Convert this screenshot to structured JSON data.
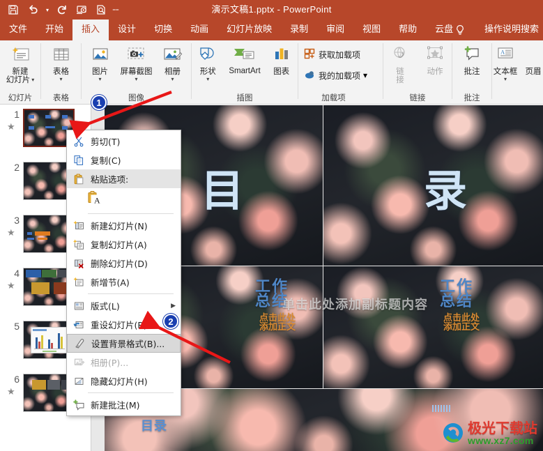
{
  "titlebar": {
    "document_title": "演示文稿1.pptx  -  PowerPoint",
    "quick_access": [
      {
        "name": "save-icon",
        "label": "保存"
      },
      {
        "name": "undo-icon",
        "label": "撤消"
      },
      {
        "name": "redo-icon",
        "label": "恢复"
      },
      {
        "name": "start-slideshow-icon",
        "label": "从头开始"
      },
      {
        "name": "print-preview-icon",
        "label": "打印预览和打印"
      },
      {
        "name": "customize-qat-icon",
        "label": "自定义快速访问工具栏"
      }
    ]
  },
  "tabs": [
    {
      "label": "文件",
      "active": false
    },
    {
      "label": "开始",
      "active": false
    },
    {
      "label": "插入",
      "active": true
    },
    {
      "label": "设计",
      "active": false
    },
    {
      "label": "切换",
      "active": false
    },
    {
      "label": "动画",
      "active": false
    },
    {
      "label": "幻灯片放映",
      "active": false
    },
    {
      "label": "录制",
      "active": false
    },
    {
      "label": "审阅",
      "active": false
    },
    {
      "label": "视图",
      "active": false
    },
    {
      "label": "帮助",
      "active": false
    },
    {
      "label": "云盘",
      "active": false
    }
  ],
  "tellme": {
    "label": "操作说明搜索",
    "icon": "lightbulb-icon"
  },
  "ribbon": {
    "groups": [
      {
        "id": "slides",
        "label": "幻灯片",
        "buttons": [
          {
            "name": "new-slide-button",
            "line1": "新建",
            "line2": "幻灯片",
            "icon": "new-slide-icon",
            "has_caret": true
          }
        ]
      },
      {
        "id": "tables",
        "label": "表格",
        "buttons": [
          {
            "name": "table-button",
            "line1": "表格",
            "line2": "",
            "icon": "table-icon",
            "has_caret": true
          }
        ]
      },
      {
        "id": "images",
        "label": "图像",
        "buttons": [
          {
            "name": "pictures-button",
            "line1": "图片",
            "line2": "",
            "icon": "picture-icon",
            "has_caret": true
          },
          {
            "name": "screenshot-button",
            "line1": "屏幕截图",
            "line2": "",
            "icon": "screenshot-icon",
            "has_caret": true
          },
          {
            "name": "photo-album-button",
            "line1": "相册",
            "line2": "",
            "icon": "photo-album-icon",
            "has_caret": true
          }
        ]
      },
      {
        "id": "illustrations",
        "label": "插图",
        "buttons": [
          {
            "name": "shapes-button",
            "line1": "形状",
            "line2": "",
            "icon": "shapes-icon",
            "has_caret": true
          },
          {
            "name": "smartart-button",
            "line1": "SmartArt",
            "line2": "",
            "icon": "smartart-icon",
            "has_caret": false
          },
          {
            "name": "chart-button",
            "line1": "图表",
            "line2": "",
            "icon": "chart-icon",
            "has_caret": false
          }
        ]
      },
      {
        "id": "addins",
        "label": "加载项",
        "small_buttons": [
          {
            "name": "get-addins-button",
            "label": "获取加载项",
            "icon": "store-icon"
          },
          {
            "name": "my-addins-button",
            "label": "我的加载项",
            "icon": "my-addins-icon",
            "has_caret": true
          }
        ]
      },
      {
        "id": "links",
        "label": "链接",
        "buttons": [
          {
            "name": "link-button",
            "line1": "链",
            "line2": "接",
            "icon": "link-icon",
            "has_caret": false,
            "disabled": true
          },
          {
            "name": "action-button",
            "line1": "动作",
            "line2": "",
            "icon": "action-icon",
            "has_caret": false,
            "disabled": true
          }
        ]
      },
      {
        "id": "comments",
        "label": "批注",
        "buttons": [
          {
            "name": "new-comment-button",
            "line1": "批注",
            "line2": "",
            "icon": "comment-icon",
            "has_caret": false
          }
        ]
      },
      {
        "id": "text",
        "label": "",
        "buttons": [
          {
            "name": "text-box-button",
            "line1": "文本框",
            "line2": "",
            "icon": "text-box-icon",
            "has_caret": true
          },
          {
            "name": "header-footer-button",
            "line1": "页眉",
            "line2": "",
            "icon": "header-footer-icon",
            "has_caret": false
          }
        ]
      }
    ]
  },
  "slide_panel": {
    "slides": [
      {
        "number": "1",
        "star": "★",
        "selected": true
      },
      {
        "number": "2",
        "star": "",
        "selected": false
      },
      {
        "number": "3",
        "star": "★",
        "selected": false
      },
      {
        "number": "4",
        "star": "★",
        "selected": false
      },
      {
        "number": "5",
        "star": "",
        "selected": false
      },
      {
        "number": "6",
        "star": "★",
        "selected": false
      }
    ]
  },
  "context_menu": {
    "items": [
      {
        "label": "剪切(T)",
        "icon": "cut-icon",
        "type": "item",
        "state": "normal"
      },
      {
        "label": "复制(C)",
        "icon": "copy-icon",
        "type": "item",
        "state": "normal"
      },
      {
        "label": "粘贴选项:",
        "icon": "paste-icon",
        "type": "header",
        "state": "highlight"
      },
      {
        "label": "",
        "icon": "paste-keep-text-icon",
        "type": "paste-gallery",
        "state": "normal"
      },
      {
        "type": "separator"
      },
      {
        "label": "新建幻灯片(N)",
        "icon": "new-slide-small-icon",
        "type": "item",
        "state": "normal"
      },
      {
        "label": "复制幻灯片(A)",
        "icon": "duplicate-slide-icon",
        "type": "item",
        "state": "normal"
      },
      {
        "label": "删除幻灯片(D)",
        "icon": "delete-slide-icon",
        "type": "item",
        "state": "normal"
      },
      {
        "label": "新增节(A)",
        "icon": "new-section-icon",
        "type": "item",
        "state": "normal"
      },
      {
        "type": "separator"
      },
      {
        "label": "版式(L)",
        "icon": "layout-icon",
        "type": "submenu",
        "state": "normal"
      },
      {
        "label": "重设幻灯片(R)",
        "icon": "reset-slide-icon",
        "type": "item",
        "state": "normal"
      },
      {
        "label": "设置背景格式(B)...",
        "icon": "format-background-icon",
        "type": "item",
        "state": "selected"
      },
      {
        "label": "相册(P)...",
        "icon": "photo-album-small-icon",
        "type": "item",
        "state": "disabled"
      },
      {
        "label": "隐藏幻灯片(H)",
        "icon": "hide-slide-icon",
        "type": "item",
        "state": "normal"
      },
      {
        "type": "separator"
      },
      {
        "label": "新建批注(M)",
        "icon": "new-comment-small-icon",
        "type": "item",
        "state": "normal"
      }
    ]
  },
  "slide_canvas": {
    "texts": {
      "contents_char_1": "目",
      "contents_char_2": "录",
      "work_title_left": "工作\n总结",
      "work_title_right": "工作\n总结",
      "body_left": "点击此处\n添加正文",
      "body_right": "点击此处\n添加正文",
      "subtitle": "单击此处添加副标题内容",
      "contents_bottom": "目录"
    }
  },
  "annotations": {
    "badges": [
      {
        "label": "1",
        "name": "annotation-badge-1"
      },
      {
        "label": "2",
        "name": "annotation-badge-2"
      }
    ],
    "accent_color": "#1a3fb0",
    "arrow_color": "#e81717"
  },
  "watermark": {
    "brand": "极光下载站",
    "url": "www.xz7.com"
  },
  "colors": {
    "ribbon_accent": "#b7472a",
    "ribbon_bg": "#f3f3f3",
    "selected_slide_border": "#7a2418"
  }
}
